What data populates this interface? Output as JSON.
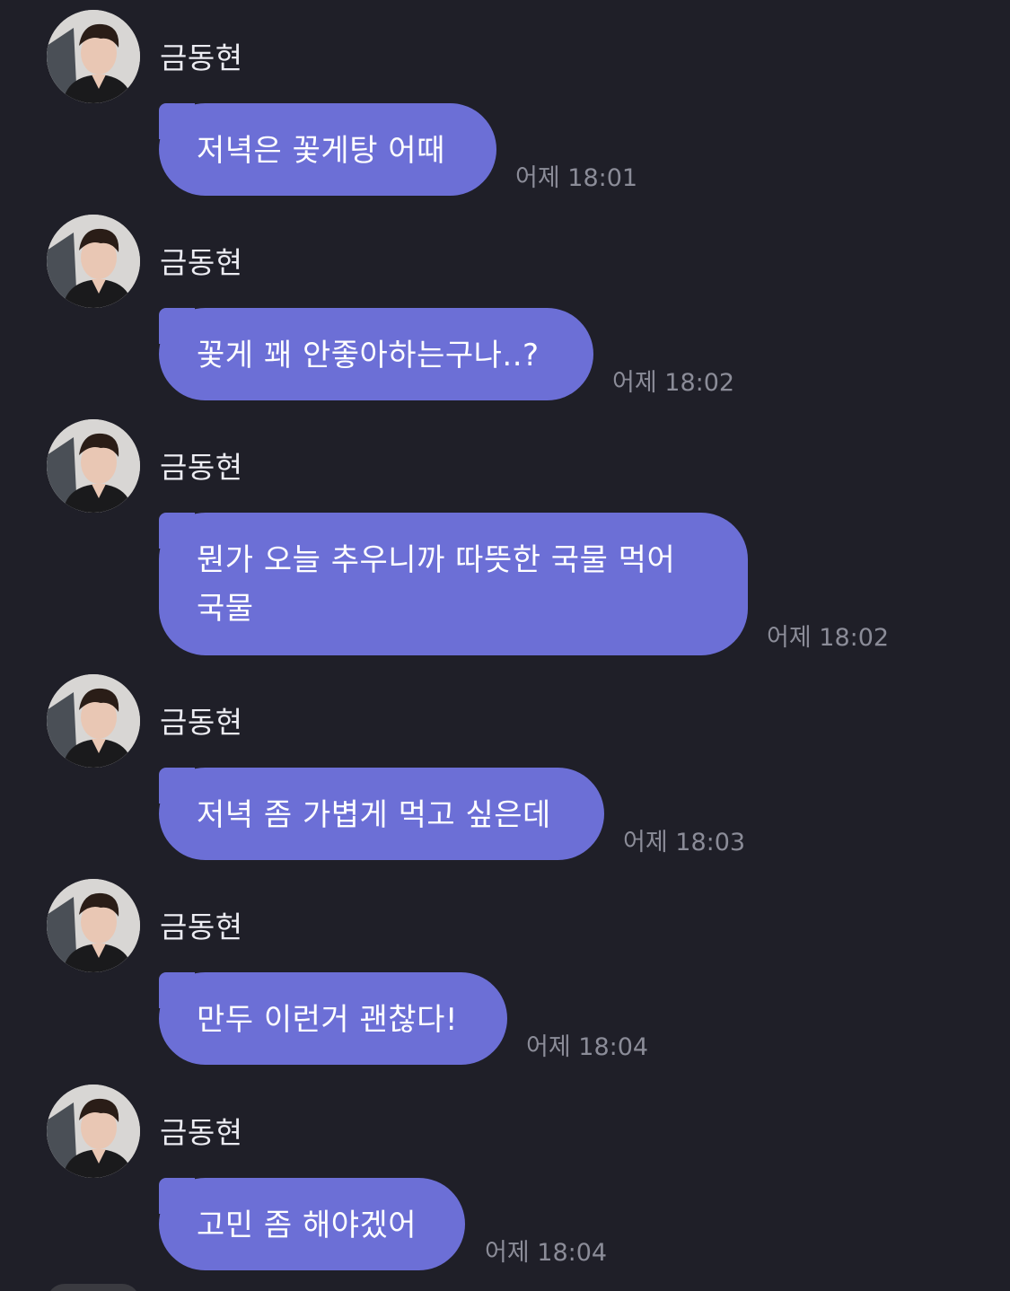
{
  "colors": {
    "background": "#1f1f28",
    "bubble": "#6c6fd6",
    "bubble_text": "#ffffff",
    "sender_text": "#ececf2",
    "time_text": "#8b8c98"
  },
  "messages": [
    {
      "sender": "금동현",
      "lines": [
        "저녁은 꽃게탕 어때"
      ],
      "time": "어제 18:01"
    },
    {
      "sender": "금동현",
      "lines": [
        "꽃게 꽤 안좋아하는구나..?"
      ],
      "time": "어제 18:02"
    },
    {
      "sender": "금동현",
      "lines": [
        "뭔가 오늘 추우니까 따뜻한 국물 먹어",
        "국물"
      ],
      "time": "어제 18:02"
    },
    {
      "sender": "금동현",
      "lines": [
        "저녁 좀 가볍게 먹고 싶은데"
      ],
      "time": "어제 18:03"
    },
    {
      "sender": "금동현",
      "lines": [
        "만두 이런거 괜찮다!"
      ],
      "time": "어제 18:04"
    },
    {
      "sender": "금동현",
      "lines": [
        "고민 좀 해야겠어"
      ],
      "time": "어제 18:04"
    }
  ]
}
